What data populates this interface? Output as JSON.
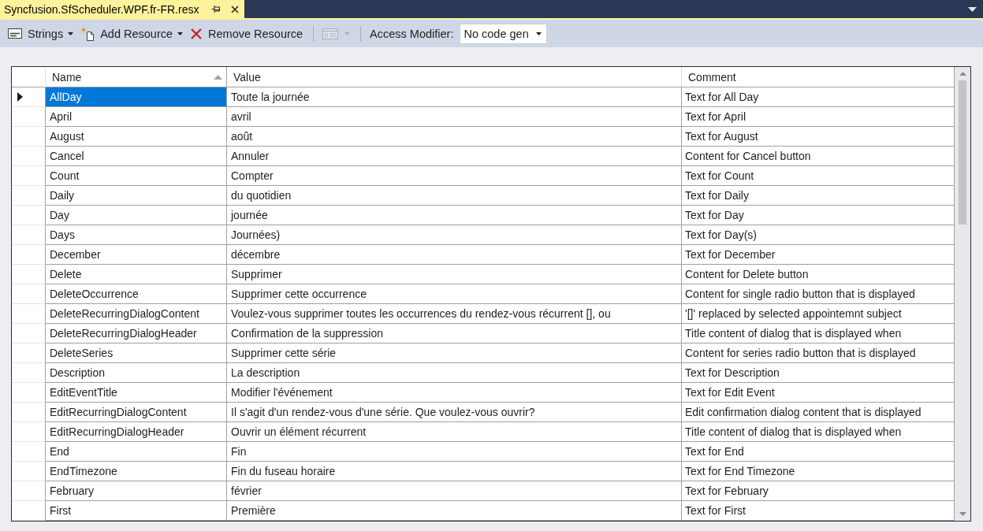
{
  "tabs": [
    {
      "title": "Syncfusion.SfScheduler.WPF.fr-FR.resx",
      "selected": true
    }
  ],
  "toolbar": {
    "items": [
      {
        "kind": "menu",
        "label": "Strings",
        "disabled": false
      },
      {
        "kind": "menu",
        "label": "Add Resource",
        "disabled": false
      },
      {
        "kind": "button",
        "label": "Remove Resource",
        "disabled": false
      },
      {
        "kind": "separator"
      },
      {
        "kind": "icon_menu",
        "disabled": true
      },
      {
        "kind": "separator"
      },
      {
        "kind": "combo",
        "label": "Access Modifier:",
        "value": "No code gen",
        "disabled": false
      }
    ]
  },
  "grid": {
    "columns": [
      {
        "label": "Name",
        "sorted": true
      },
      {
        "label": "Value",
        "sorted": false
      },
      {
        "label": "Comment",
        "sorted": false
      }
    ],
    "rows": [
      {
        "name": "AllDay",
        "value": "Toute la journée",
        "comment": "Text for All Day",
        "selected": true
      },
      {
        "name": "April",
        "value": "avril",
        "comment": "Text for April",
        "selected": false
      },
      {
        "name": "August",
        "value": "août",
        "comment": "Text for August",
        "selected": false
      },
      {
        "name": "Cancel",
        "value": "Annuler",
        "comment": "Content for Cancel button",
        "selected": false
      },
      {
        "name": "Count",
        "value": "Compter",
        "comment": "Text for Count",
        "selected": false
      },
      {
        "name": "Daily",
        "value": "du quotidien",
        "comment": "Text for Daily",
        "selected": false
      },
      {
        "name": "Day",
        "value": "journée",
        "comment": "Text for Day",
        "selected": false
      },
      {
        "name": "Days",
        "value": "Journées)",
        "comment": "Text for Day(s)",
        "selected": false
      },
      {
        "name": "December",
        "value": "décembre",
        "comment": "Text for December",
        "selected": false
      },
      {
        "name": "Delete",
        "value": "Supprimer",
        "comment": "Content for Delete button",
        "selected": false
      },
      {
        "name": "DeleteOccurrence",
        "value": "Supprimer cette occurrence",
        "comment": "Content for single radio button that is displayed",
        "selected": false
      },
      {
        "name": "DeleteRecurringDialogContent",
        "value": "Voulez-vous supprimer toutes les occurrences du rendez-vous récurrent [], ou",
        "comment": "'[]' replaced by selected appointemnt subject",
        "selected": false
      },
      {
        "name": "DeleteRecurringDialogHeader",
        "value": "Confirmation de la suppression",
        "comment": "Title content of dialog that is displayed when",
        "selected": false
      },
      {
        "name": "DeleteSeries",
        "value": "Supprimer cette série",
        "comment": "Content for series radio button that is displayed",
        "selected": false
      },
      {
        "name": "Description",
        "value": "La description",
        "comment": "Text for Description",
        "selected": false
      },
      {
        "name": "EditEventTitle",
        "value": "Modifier l'événement",
        "comment": "Text for Edit Event",
        "selected": false
      },
      {
        "name": "EditRecurringDialogContent",
        "value": "Il s'agit d'un rendez-vous d'une série. Que voulez-vous ouvrir?",
        "comment": "Edit confirmation dialog content that is displayed",
        "selected": false
      },
      {
        "name": "EditRecurringDialogHeader",
        "value": "Ouvrir un élément récurrent",
        "comment": "Title content of dialog that is displayed when",
        "selected": false
      },
      {
        "name": "End",
        "value": "Fin",
        "comment": "Text for End",
        "selected": false
      },
      {
        "name": "EndTimezone",
        "value": "Fin du fuseau horaire",
        "comment": "Text for End Timezone",
        "selected": false
      },
      {
        "name": "February",
        "value": "février",
        "comment": "Text for February",
        "selected": false
      },
      {
        "name": "First",
        "value": "Première",
        "comment": "Text for First",
        "selected": false
      }
    ]
  }
}
